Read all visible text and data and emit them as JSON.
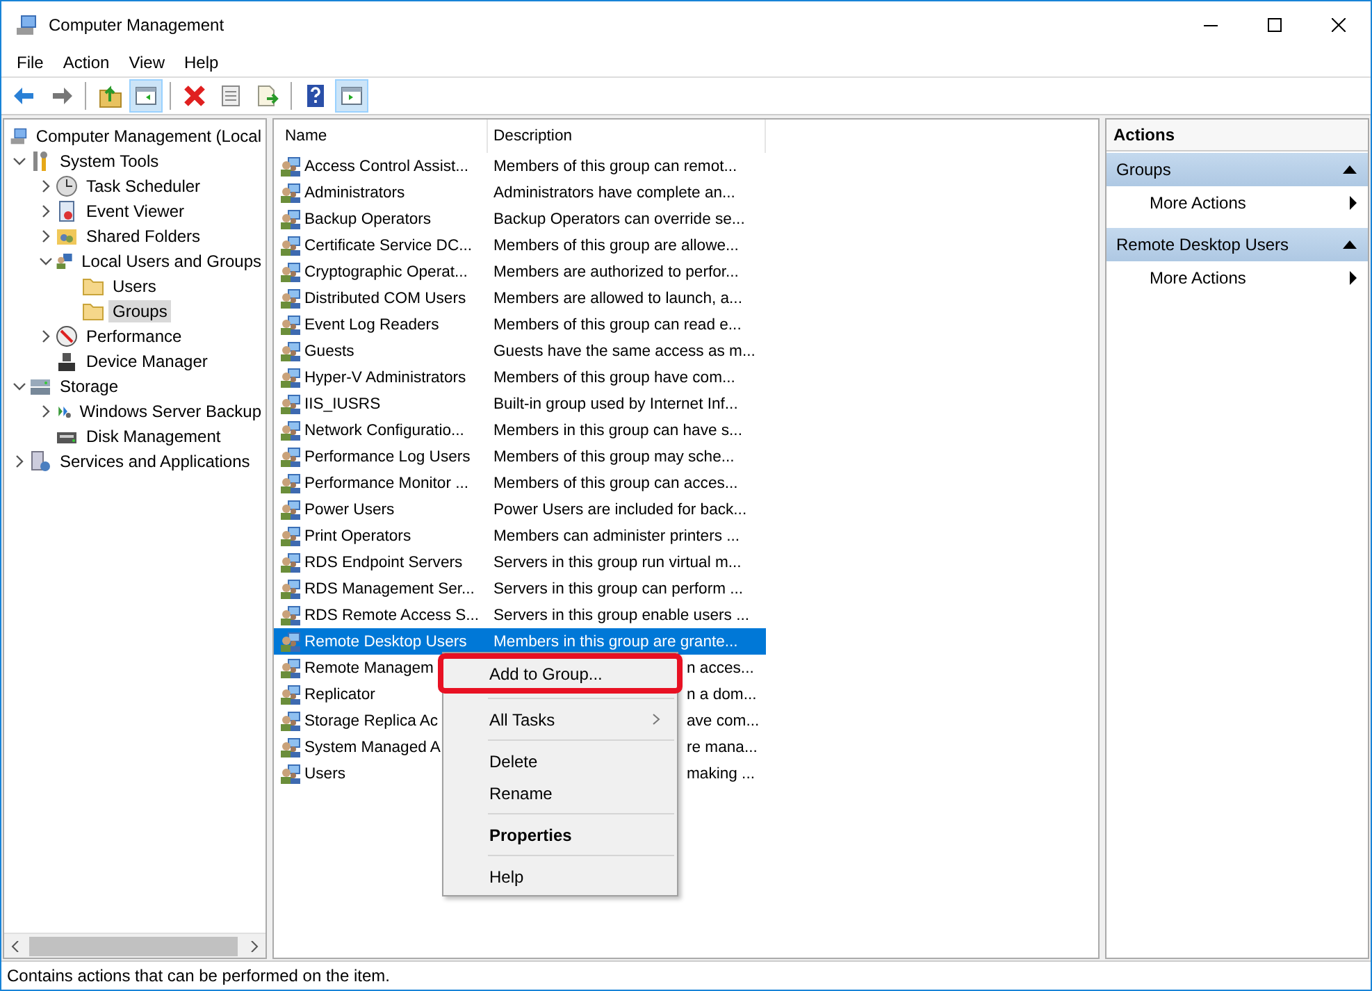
{
  "window": {
    "title": "Computer Management"
  },
  "menu_bar": [
    "File",
    "Action",
    "View",
    "Help"
  ],
  "toolbar": [
    {
      "kind": "back",
      "pressed": false
    },
    {
      "kind": "forward",
      "pressed": false
    },
    {
      "kind": "separator"
    },
    {
      "kind": "up-folder",
      "pressed": false
    },
    {
      "kind": "tree-pane",
      "pressed": true
    },
    {
      "kind": "separator"
    },
    {
      "kind": "delete",
      "pressed": false
    },
    {
      "kind": "properties",
      "pressed": false
    },
    {
      "kind": "export",
      "pressed": false
    },
    {
      "kind": "separator"
    },
    {
      "kind": "help",
      "pressed": false
    },
    {
      "kind": "action-pane",
      "pressed": true
    }
  ],
  "tree": {
    "items": [
      {
        "label": "Computer Management (Local",
        "kind": "computer",
        "selected": false,
        "children": [
          {
            "label": "System Tools",
            "kind": "tools",
            "expanded": true,
            "selected": false,
            "children": [
              {
                "label": "Task Scheduler",
                "kind": "clock",
                "expanded": false,
                "selected": false
              },
              {
                "label": "Event Viewer",
                "kind": "event",
                "expanded": false,
                "selected": false
              },
              {
                "label": "Shared Folders",
                "kind": "shared",
                "expanded": false,
                "selected": false
              },
              {
                "label": "Local Users and Groups",
                "kind": "users",
                "expanded": true,
                "selected": false,
                "children": [
                  {
                    "label": "Users",
                    "kind": "folder",
                    "selected": false
                  },
                  {
                    "label": "Groups",
                    "kind": "folder",
                    "selected": true
                  }
                ]
              },
              {
                "label": "Performance",
                "kind": "performance",
                "expanded": false,
                "selected": false
              },
              {
                "label": "Device Manager",
                "kind": "device",
                "selected": false
              }
            ]
          },
          {
            "label": "Storage",
            "kind": "storage",
            "expanded": true,
            "selected": false,
            "children": [
              {
                "label": "Windows Server Backup",
                "kind": "backup",
                "expanded": false,
                "selected": false
              },
              {
                "label": "Disk Management",
                "kind": "disk",
                "selected": false
              }
            ]
          },
          {
            "label": "Services and Applications",
            "kind": "services",
            "expanded": false,
            "selected": false
          }
        ]
      }
    ]
  },
  "list": {
    "columns": [
      "Name",
      "Description"
    ],
    "rows": [
      {
        "name": "Access Control Assist...",
        "description": "Members of this group can remot...",
        "selected": false,
        "covered": false
      },
      {
        "name": "Administrators",
        "description": "Administrators have complete an...",
        "selected": false,
        "covered": false
      },
      {
        "name": "Backup Operators",
        "description": "Backup Operators can override se...",
        "selected": false,
        "covered": false
      },
      {
        "name": "Certificate Service DC...",
        "description": "Members of this group are allowe...",
        "selected": false,
        "covered": false
      },
      {
        "name": "Cryptographic Operat...",
        "description": "Members are authorized to perfor...",
        "selected": false,
        "covered": false
      },
      {
        "name": "Distributed COM Users",
        "description": "Members are allowed to launch, a...",
        "selected": false,
        "covered": false
      },
      {
        "name": "Event Log Readers",
        "description": "Members of this group can read e...",
        "selected": false,
        "covered": false
      },
      {
        "name": "Guests",
        "description": "Guests have the same access as m...",
        "selected": false,
        "covered": false
      },
      {
        "name": "Hyper-V Administrators",
        "description": "Members of this group have com...",
        "selected": false,
        "covered": false
      },
      {
        "name": "IIS_IUSRS",
        "description": "Built-in group used by Internet Inf...",
        "selected": false,
        "covered": false
      },
      {
        "name": "Network Configuratio...",
        "description": "Members in this group can have s...",
        "selected": false,
        "covered": false
      },
      {
        "name": "Performance Log Users",
        "description": "Members of this group may sche...",
        "selected": false,
        "covered": false
      },
      {
        "name": "Performance Monitor ...",
        "description": "Members of this group can acces...",
        "selected": false,
        "covered": false
      },
      {
        "name": "Power Users",
        "description": "Power Users are included for back...",
        "selected": false,
        "covered": false
      },
      {
        "name": "Print Operators",
        "description": "Members can administer printers ...",
        "selected": false,
        "covered": false
      },
      {
        "name": "RDS Endpoint Servers",
        "description": "Servers in this group run virtual m...",
        "selected": false,
        "covered": false
      },
      {
        "name": "RDS Management Ser...",
        "description": "Servers in this group can perform ...",
        "selected": false,
        "covered": false
      },
      {
        "name": "RDS Remote Access S...",
        "description": "Servers in this group enable users ...",
        "selected": false,
        "covered": false
      },
      {
        "name": "Remote Desktop Users",
        "description": "Members in this group are grante...",
        "selected": true,
        "covered": false
      },
      {
        "name": "Remote Managem",
        "description": "n acces...",
        "selected": false,
        "covered": true
      },
      {
        "name": "Replicator",
        "description": "n a dom...",
        "selected": false,
        "covered": true
      },
      {
        "name": "Storage Replica Ac",
        "description": "ave com...",
        "selected": false,
        "covered": true
      },
      {
        "name": "System Managed A",
        "description": "re mana...",
        "selected": false,
        "covered": true
      },
      {
        "name": "Users",
        "description": "making ...",
        "selected": false,
        "covered": true
      }
    ]
  },
  "context_menu": [
    {
      "kind": "item",
      "label": "Add to Group...",
      "outlined": true,
      "default": false
    },
    {
      "kind": "separator"
    },
    {
      "kind": "submenu",
      "label": "All Tasks",
      "outlined": false,
      "default": false
    },
    {
      "kind": "separator"
    },
    {
      "kind": "item",
      "label": "Delete",
      "outlined": false,
      "default": false
    },
    {
      "kind": "item",
      "label": "Rename",
      "outlined": false,
      "default": false
    },
    {
      "kind": "separator"
    },
    {
      "kind": "item",
      "label": "Properties",
      "outlined": false,
      "default": true
    },
    {
      "kind": "separator"
    },
    {
      "kind": "item",
      "label": "Help",
      "outlined": false,
      "default": false
    }
  ],
  "actions": {
    "title": "Actions",
    "sections": [
      {
        "title": "Groups",
        "expanded": true,
        "items": [
          "More Actions"
        ]
      },
      {
        "title": "Remote Desktop Users",
        "expanded": true,
        "items": [
          "More Actions"
        ]
      }
    ]
  },
  "status_bar": "Contains actions that can be performed on the item."
}
